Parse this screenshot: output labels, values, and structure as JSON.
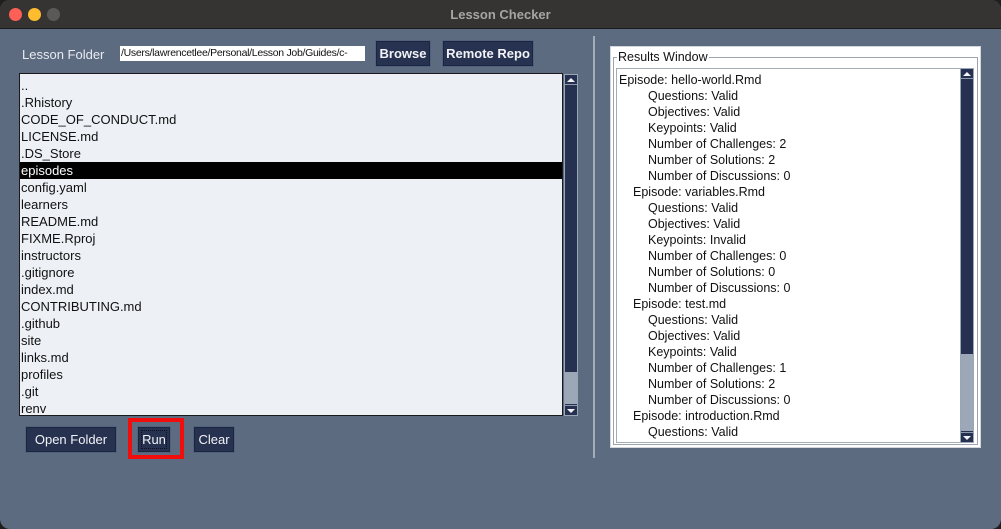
{
  "window": {
    "title": "Lesson Checker"
  },
  "folder": {
    "label": "Lesson Folder",
    "path_value": "/Users/lawrencetlee/Personal/Lesson Job/Guides/c-",
    "browse_label": "Browse",
    "remote_repo_label": "Remote Repo"
  },
  "file_list": {
    "selected_index": 5,
    "items": [
      "..",
      ".Rhistory",
      "CODE_OF_CONDUCT.md",
      "LICENSE.md",
      ".DS_Store",
      "episodes",
      "config.yaml",
      "learners",
      "README.md",
      "FIXME.Rproj",
      "instructors",
      ".gitignore",
      "index.md",
      "CONTRIBUTING.md",
      ".github",
      "site",
      "links.md",
      "profiles",
      ".git",
      "renv"
    ],
    "scroll_thumb_fraction": 0.9
  },
  "actions": {
    "open_folder_label": "Open Folder",
    "run_label": "Run",
    "clear_label": "Clear"
  },
  "results": {
    "legend": "Results Window",
    "scroll_thumb_fraction": 0.78,
    "lines": [
      {
        "text": "Episode: hello-world.Rmd",
        "level": 0
      },
      {
        "text": "Questions: Valid",
        "level": 2
      },
      {
        "text": "Objectives: Valid",
        "level": 2
      },
      {
        "text": "Keypoints: Valid",
        "level": 2
      },
      {
        "text": "Number of Challenges: 2",
        "level": 2
      },
      {
        "text": "Number of Solutions: 2",
        "level": 2
      },
      {
        "text": "Number of Discussions: 0",
        "level": 2
      },
      {
        "text": "Episode: variables.Rmd",
        "level": 1
      },
      {
        "text": "Questions: Valid",
        "level": 2
      },
      {
        "text": "Objectives: Valid",
        "level": 2
      },
      {
        "text": "Keypoints: Invalid",
        "level": 2
      },
      {
        "text": "Number of Challenges: 0",
        "level": 2
      },
      {
        "text": "Number of Solutions: 0",
        "level": 2
      },
      {
        "text": "Number of Discussions: 0",
        "level": 2
      },
      {
        "text": "Episode: test.md",
        "level": 1
      },
      {
        "text": "Questions: Valid",
        "level": 2
      },
      {
        "text": "Objectives: Valid",
        "level": 2
      },
      {
        "text": "Keypoints: Valid",
        "level": 2
      },
      {
        "text": "Number of Challenges: 1",
        "level": 2
      },
      {
        "text": "Number of Solutions: 2",
        "level": 2
      },
      {
        "text": "Number of Discussions: 0",
        "level": 2
      },
      {
        "text": "Episode: introduction.Rmd",
        "level": 1
      },
      {
        "text": "Questions: Valid",
        "level": 2
      }
    ]
  },
  "colors": {
    "window_bg": "#5c6b80",
    "button_bg": "#273250",
    "highlight_annotation": "#f20d0d",
    "selection_bg": "#000000"
  }
}
